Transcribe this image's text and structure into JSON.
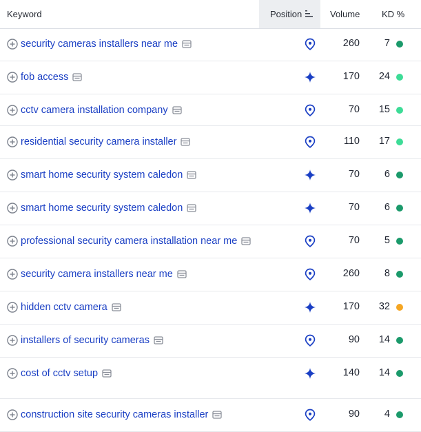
{
  "headers": {
    "keyword": "Keyword",
    "position": "Position",
    "volume": "Volume",
    "kd": "KD %"
  },
  "colors": {
    "link": "#1a3fc4",
    "icon_blue": "#1a3fc4",
    "kd_dark_green": "#1b9a6b",
    "kd_light_green": "#3ddc97",
    "kd_orange": "#f5a623"
  },
  "rows": [
    {
      "keyword": "security cameras installers near me",
      "position_icon": "location-pin-icon",
      "volume": "260",
      "kd": "7",
      "kd_color": "#1b9a6b"
    },
    {
      "keyword": "fob access",
      "position_icon": "sparkle-icon",
      "volume": "170",
      "kd": "24",
      "kd_color": "#3ddc97"
    },
    {
      "keyword": "cctv camera installation company",
      "position_icon": "location-pin-icon",
      "volume": "70",
      "kd": "15",
      "kd_color": "#3ddc97"
    },
    {
      "keyword": "residential security camera installer",
      "position_icon": "location-pin-icon",
      "volume": "110",
      "kd": "17",
      "kd_color": "#3ddc97"
    },
    {
      "keyword": "smart home security system caledon",
      "position_icon": "sparkle-icon",
      "volume": "70",
      "kd": "6",
      "kd_color": "#1b9a6b"
    },
    {
      "keyword": "smart home security system caledon",
      "position_icon": "sparkle-icon",
      "volume": "70",
      "kd": "6",
      "kd_color": "#1b9a6b"
    },
    {
      "keyword": "professional security camera installation near me",
      "position_icon": "location-pin-icon",
      "volume": "70",
      "kd": "5",
      "kd_color": "#1b9a6b"
    },
    {
      "keyword": "security camera installers near me",
      "position_icon": "location-pin-icon",
      "volume": "260",
      "kd": "8",
      "kd_color": "#1b9a6b"
    },
    {
      "keyword": "hidden cctv camera",
      "position_icon": "sparkle-icon",
      "volume": "170",
      "kd": "32",
      "kd_color": "#f5a623"
    },
    {
      "keyword": "installers of security cameras",
      "position_icon": "location-pin-icon",
      "volume": "90",
      "kd": "14",
      "kd_color": "#1b9a6b"
    },
    {
      "keyword": "cost of cctv setup",
      "position_icon": "sparkle-icon",
      "volume": "140",
      "kd": "14",
      "kd_color": "#1b9a6b"
    },
    {
      "keyword": "construction site security cameras installer",
      "position_icon": "location-pin-icon",
      "volume": "90",
      "kd": "4",
      "kd_color": "#1b9a6b"
    }
  ]
}
